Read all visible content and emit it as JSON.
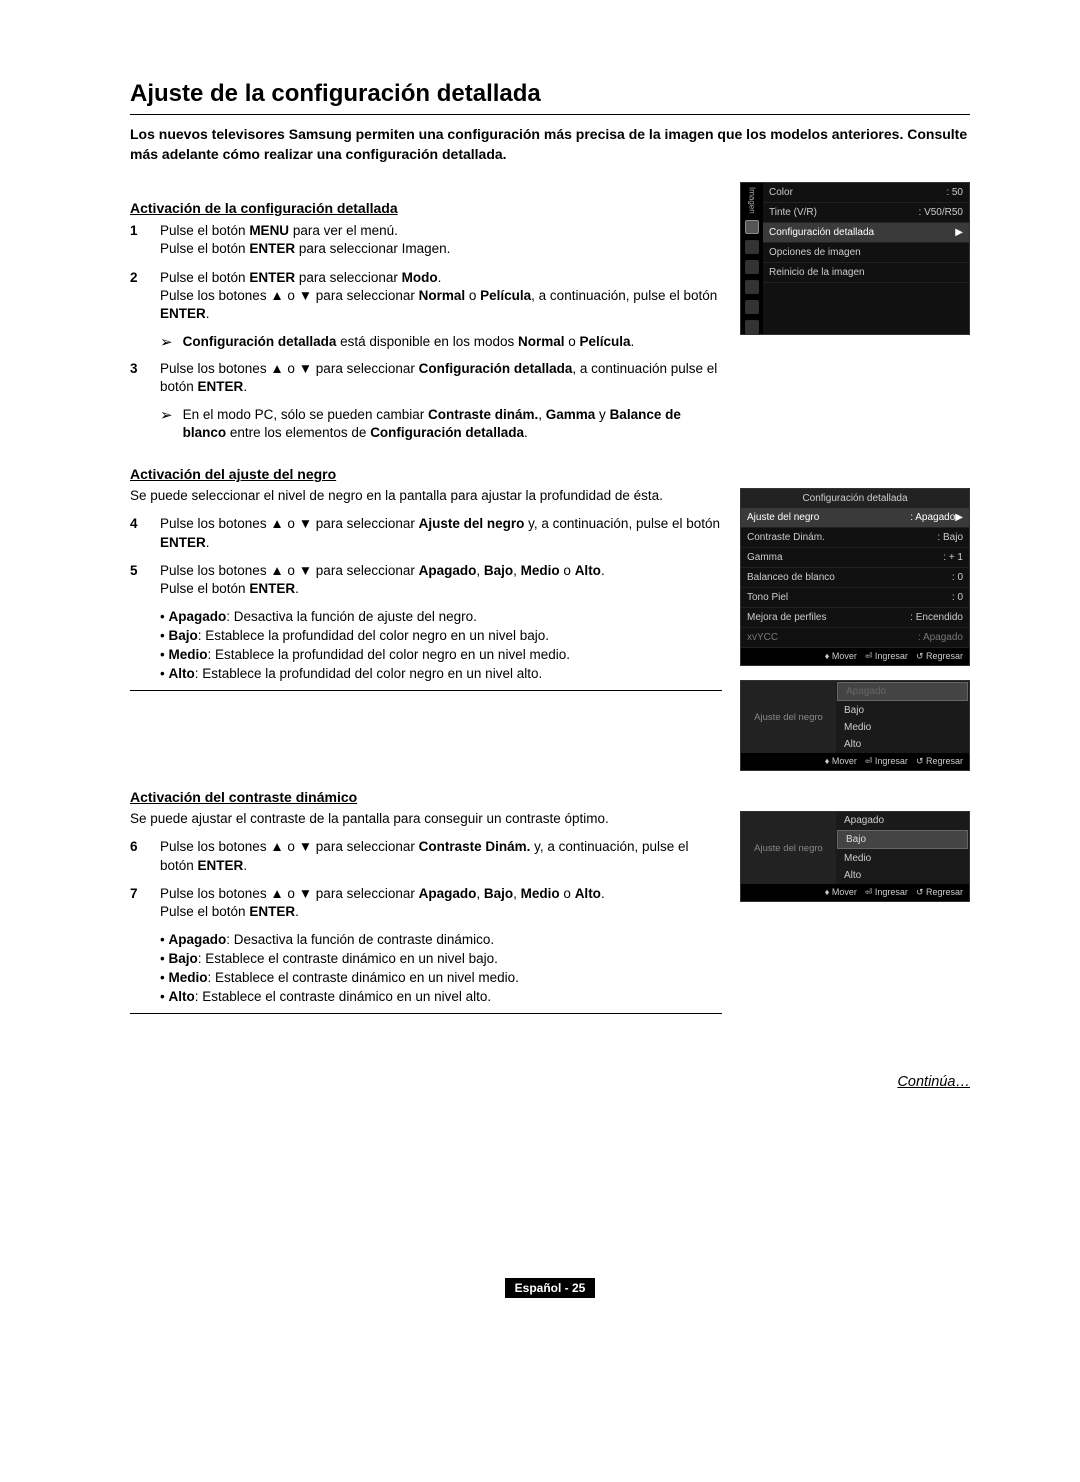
{
  "page": {
    "title": "Ajuste de la configuración detallada",
    "intro": "Los nuevos televisores Samsung permiten una configuración más precisa de la imagen que los modelos anteriores. Consulte más adelante cómo realizar una configuración detallada.",
    "continue": "Continúa…",
    "footer": "Español - 25"
  },
  "sec1": {
    "heading": "Activación de la configuración detallada",
    "s1": {
      "n": "1",
      "l1_a": "Pulse el botón ",
      "l1_b": "MENU",
      "l1_c": " para ver el menú.",
      "l2_a": "Pulse el botón ",
      "l2_b": "ENTER",
      "l2_c": " para seleccionar Imagen."
    },
    "s2": {
      "n": "2",
      "l1_a": "Pulse el botón  ",
      "l1_b": "ENTER",
      "l1_c": " para seleccionar ",
      "l1_d": "Modo",
      "l1_e": ".",
      "l2_a": "Pulse los botones ▲ o ▼ para seleccionar ",
      "l2_b": "Normal",
      "l2_c": " o ",
      "l2_d": "Película",
      "l2_e": ", a continuación, pulse el botón ",
      "l2_f": "ENTER",
      "l2_g": "."
    },
    "note2": {
      "a": "Configuración detallada",
      "b": " está disponible en los modos ",
      "c": "Normal",
      "d": " o ",
      "e": "Película",
      "f": "."
    },
    "s3": {
      "n": "3",
      "l1_a": "Pulse los botones ▲ o ▼ para seleccionar ",
      "l1_b": "Configuración detallada",
      "l1_c": ", a continuación pulse el botón ",
      "l1_d": "ENTER",
      "l1_e": "."
    },
    "note3": {
      "a": "En el modo PC, sólo se pueden cambiar ",
      "b": "Contraste dinám.",
      "c": ", ",
      "d": "Gamma",
      "e": " y ",
      "f": "Balance de blanco",
      "g": " entre los elementos de ",
      "h": "Configuración detallada",
      "i": "."
    }
  },
  "sec2": {
    "heading": "Activación del ajuste del negro",
    "desc": "Se puede seleccionar el nivel de negro en la pantalla para ajustar la profundidad de ésta.",
    "s4": {
      "n": "4",
      "a": "Pulse los botones ▲ o ▼ para seleccionar ",
      "b": "Ajuste del negro",
      "c": " y, a continuación, pulse el botón ",
      "d": "ENTER",
      "e": "."
    },
    "s5": {
      "n": "5",
      "a": "Pulse los botones ▲ o ▼ para seleccionar ",
      "b": "Apagado",
      "c": ", ",
      "d": "Bajo",
      "e": ", ",
      "f": "Medio",
      "g": " o ",
      "h": "Alto",
      "i": ".",
      "l2a": "Pulse el botón ",
      "l2b": "ENTER",
      "l2c": "."
    },
    "bul": {
      "b1a": "Apagado",
      "b1b": ": Desactiva la función de ajuste del negro.",
      "b2a": "Bajo",
      "b2b": ": Establece la profundidad del color negro en un nivel bajo.",
      "b3a": "Medio",
      "b3b": ": Establece la profundidad del color negro en un nivel medio.",
      "b4a": "Alto",
      "b4b": ": Establece la profundidad del color negro en un nivel alto."
    }
  },
  "sec3": {
    "heading": "Activación del contraste dinámico",
    "desc": "Se puede ajustar el contraste de la pantalla para conseguir un contraste óptimo.",
    "s6": {
      "n": "6",
      "a": "Pulse los botones ▲ o ▼ para seleccionar ",
      "b": "Contraste Dinám.",
      "c": " y, a continuación, pulse el botón ",
      "d": "ENTER",
      "e": "."
    },
    "s7": {
      "n": "7",
      "a": "Pulse los botones ▲ o ▼ para seleccionar ",
      "b": "Apagado",
      "c": ", ",
      "d": "Bajo",
      "e": ", ",
      "f": "Medio",
      "g": " o ",
      "h": "Alto",
      "i": ".",
      "l2a": "Pulse el botón ",
      "l2b": "ENTER",
      "l2c": "."
    },
    "bul": {
      "b1a": "Apagado",
      "b1b": ": Desactiva la función de contraste dinámico.",
      "b2a": "Bajo",
      "b2b": ": Establece el contraste dinámico en un nivel bajo.",
      "b3a": "Medio",
      "b3b": ": Establece el contraste dinámico en un nivel medio.",
      "b4a": "Alto",
      "b4b": ": Establece el contraste dinámico en un nivel alto."
    }
  },
  "osd1": {
    "sidebar_label": "Imagen",
    "r1": {
      "lab": "Color",
      "val": "50"
    },
    "r2": {
      "lab": "Tinte (V/R)",
      "val": "V50/R50"
    },
    "r3": {
      "lab": "Configuración detallada"
    },
    "r4": {
      "lab": "Opciones de imagen"
    },
    "r5": {
      "lab": "Reinicio de la imagen"
    }
  },
  "osd2": {
    "title": "Configuración detallada",
    "rows": [
      {
        "lab": "Ajuste del negro",
        "val": "Apagado",
        "hi": true
      },
      {
        "lab": "Contraste Dinám.",
        "val": "Bajo"
      },
      {
        "lab": "Gamma",
        "val": "+ 1"
      },
      {
        "lab": "Balanceo de blanco",
        "val": "0"
      },
      {
        "lab": "Tono Piel",
        "val": "0"
      },
      {
        "lab": "Mejora de perfiles",
        "val": "Encendido"
      },
      {
        "lab": "xvYCC",
        "val": "Apagado",
        "dim": true
      }
    ],
    "f1": "Mover",
    "f2": "Ingresar",
    "f3": "Regresar"
  },
  "osd3": {
    "left": "Ajuste del negro",
    "opts": [
      "Apagado",
      "Bajo",
      "Medio",
      "Alto"
    ],
    "sel": 0,
    "f1": "Mover",
    "f2": "Ingresar",
    "f3": "Regresar"
  },
  "osd4": {
    "left": "Ajuste del negro",
    "opts": [
      "Apagado",
      "Bajo",
      "Medio",
      "Alto"
    ],
    "sel": 1,
    "f1": "Mover",
    "f2": "Ingresar",
    "f3": "Regresar"
  }
}
